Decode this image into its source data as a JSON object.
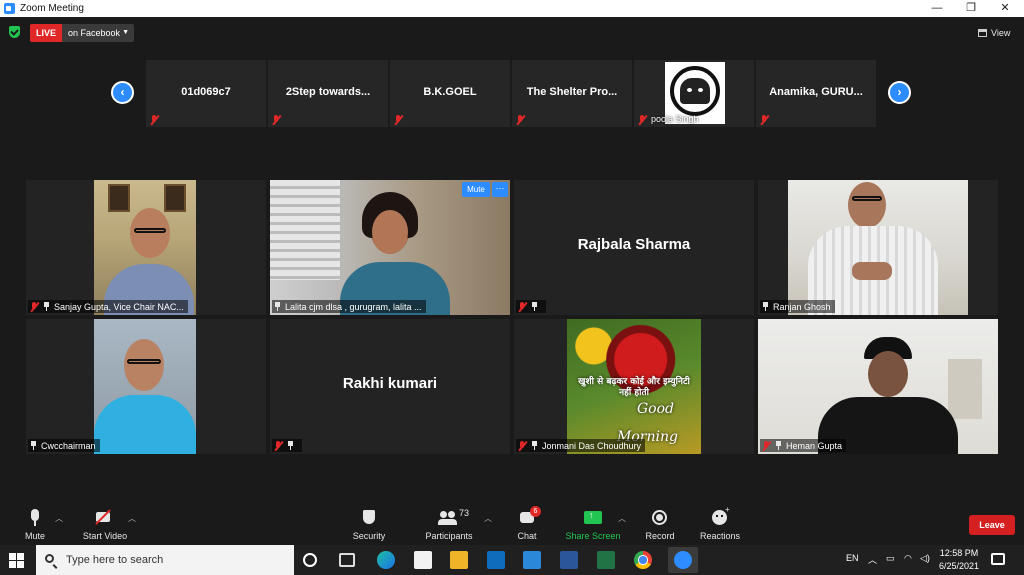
{
  "window": {
    "title": "Zoom Meeting",
    "controls": [
      "—",
      "❐",
      "✕"
    ]
  },
  "header": {
    "live_label": "LIVE",
    "live_target": "on Facebook",
    "view_label": "View"
  },
  "strip": {
    "prev": "‹",
    "next": "›",
    "participants": [
      {
        "name": "01d069c7"
      },
      {
        "name": "2Step towards..."
      },
      {
        "name": "B.K.GOEL"
      },
      {
        "name": "The Shelter Pro..."
      },
      {
        "name": "pooja Singh"
      },
      {
        "name": "Anamika, GURU..."
      }
    ]
  },
  "gallery": [
    {
      "name": "Sanjay Gupta, Vice Chair NAC..."
    },
    {
      "name": "Lalita cjm dlsa , gurugram, lalita ..."
    },
    {
      "name": "Rajbala Sharma",
      "big_name": "Rajbala Sharma"
    },
    {
      "name": "Ranjan Ghosh"
    },
    {
      "name": "Cwcchairman"
    },
    {
      "name": "",
      "big_name": "Rakhi kumari"
    },
    {
      "name": "Jonmani Das Choudhury",
      "overlay_text": "खुशी से बढ़कर कोई और इम्युनिटी नहीं होती",
      "overlay_good": "Good",
      "overlay_morning": "Morning"
    },
    {
      "name": "Heman Gupta"
    }
  ],
  "tile_actions": {
    "mute": "Mute",
    "more": "···"
  },
  "toolbar": {
    "mute": "Mute",
    "start_video": "Start Video",
    "security": "Security",
    "participants": "Participants",
    "participants_count": "73",
    "chat": "Chat",
    "chat_badge": "6",
    "share_screen": "Share Screen",
    "record": "Record",
    "reactions": "Reactions",
    "leave": "Leave"
  },
  "taskbar": {
    "search_placeholder": "Type here to search",
    "language": "EN",
    "time": "12:58 PM",
    "date": "6/25/2021"
  },
  "colors": {
    "accent": "#2d8cff",
    "live": "#e02828",
    "share": "#23c552",
    "leave": "#d42020"
  }
}
